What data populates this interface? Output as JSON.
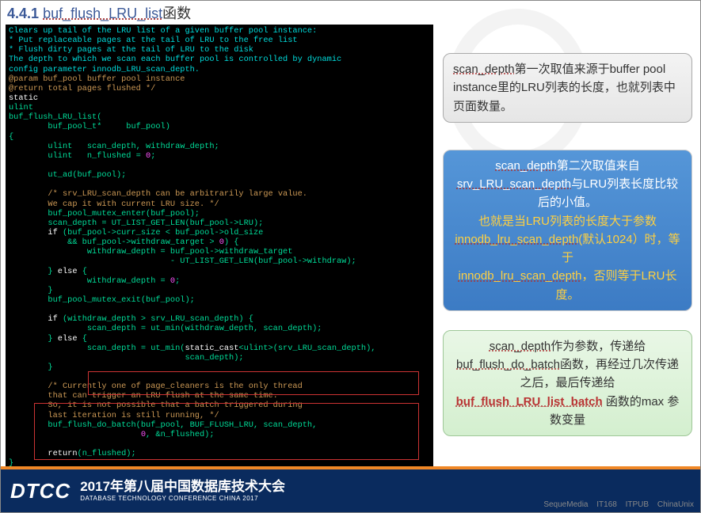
{
  "header": {
    "section": "4.4.1",
    "func": "buf_flush_LRU_list",
    "suffix": "函数"
  },
  "code": {
    "c1": "Clears up tail of the LRU list of a given buffer pool instance:",
    "c2": "* Put replaceable pages at the tail of LRU to the free list",
    "c3": "* Flush dirty pages at the tail of LRU to the disk",
    "c4": "The depth to which we scan each buffer pool is controlled by dynamic",
    "c5": "config parameter innodb_LRU_scan_depth.",
    "c6": "@param buf_pool buffer pool instance",
    "c7": "@return total pages flushed */",
    "kw_static": "static",
    "kw_ulint": "ulint",
    "fn": "buf_flush_LRU_list(",
    "p1": "        buf_pool_t*     buf_pool)",
    "ob": "{",
    "d1": "        ulint   scan_depth, withdraw_depth;",
    "d2a": "        ulint   n_flushed = ",
    "d2b": "0",
    "d2c": ";",
    "a1": "        ut_ad(buf_pool);",
    "cc1": "        /* srv_LRU_scan_depth can be arbitrarily large value.",
    "cc2": "        We cap it with current LRU size. */",
    "s1": "        buf_pool_mutex_enter(buf_pool);",
    "s2": "        scan_depth = UT_LIST_GET_LEN(buf_pool->LRU);",
    "s3a": "        if",
    "s3b": " (buf_pool->curr_size < buf_pool->old_size",
    "s4a": "            && buf_pool->withdraw_target > ",
    "s4b": "0",
    "s4c": ") {",
    "s5": "                withdraw_depth = buf_pool->withdraw_target",
    "s6": "                                 - UT_LIST_GET_LEN(buf_pool->withdraw);",
    "s7a": "        } ",
    "s7b": "else",
    "s7c": " {",
    "s8a": "                withdraw_depth = ",
    "s8b": "0",
    "s8c": ";",
    "s9": "        }",
    "s10": "        buf_pool_mutex_exit(buf_pool);",
    "s11a": "        if",
    "s11b": " (withdraw_depth > srv_LRU_scan_depth) {",
    "s12": "                scan_depth = ut_min(withdraw_depth, scan_depth);",
    "s13a": "        } ",
    "s13b": "else",
    "s13c": " {",
    "s14a": "                scan_depth = ut_min(",
    "s14b": "static_cast",
    "s14c": "<ulint>(srv_LRU_scan_depth),",
    "s15": "                                    scan_depth);",
    "s16": "        }",
    "cc3": "        /* Currently one of page_cleaners is the only thread",
    "cc4": "        that can trigger an LRU flush at the same time.",
    "cc5": "        So, it is not possible that a batch triggered during",
    "cc6": "        last iteration is still running, */",
    "s17": "        buf_flush_do_batch(buf_pool, BUF_FLUSH_LRU, scan_depth,",
    "s18a": "                           ",
    "s18b": "0",
    "s18c": ", &n_flushed);",
    "ret": "        return",
    "retv": "(n_flushed);",
    "cb": "}"
  },
  "callout1": {
    "a": "scan_depth",
    "b": "第一次取值来源于buffer pool instance里的LRU列表的长度，也就列表中页面数量。"
  },
  "callout2": {
    "a": "scan_depth",
    "b": "第二次取值来自",
    "c": "srv_LRU_scan_depth",
    "d": "与LRU列表长度比较后的小值。",
    "e": "也就是当LRU列表的长度大于参数",
    "f": "innodb_lru_scan_depth(",
    "g": "默认1024）时，等于",
    "h": "innodb_lru_scan_depth",
    "i": "，否则等于LRU长度。"
  },
  "callout3": {
    "a": "scan_depth",
    "b": "作为参数，传递给",
    "c": "buf_flush_do_batch",
    "d": "函数，再经过几次传递之后，最后传递给",
    "e": "buf_flush_LRU_list_batch",
    "f": " 函数的max 参数变量"
  },
  "footer": {
    "logo": "DTCC",
    "title": "2017年第八届中国数据库技术大会",
    "subtitle": "DATABASE  TECHNOLOGY  CONFERENCE  CHINA 2017",
    "sponsors": [
      "SequeMedia",
      "IT168",
      "ITPUB",
      "ChinaUnix"
    ]
  }
}
